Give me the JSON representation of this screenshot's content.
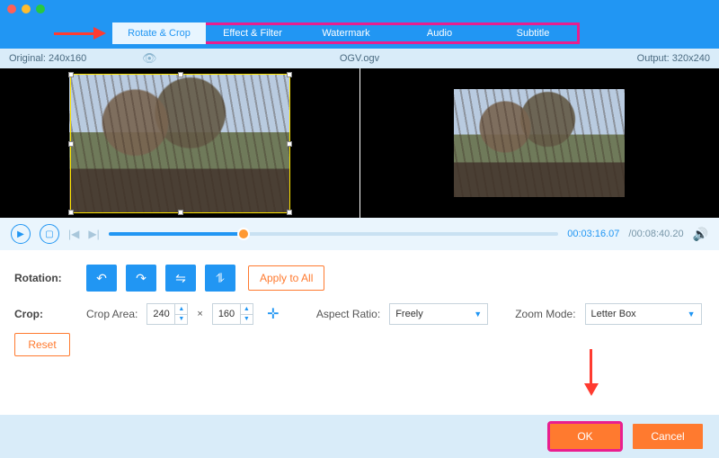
{
  "window": {
    "traffic": [
      "close",
      "min",
      "max"
    ]
  },
  "tabs": [
    "Rotate & Crop",
    "Effect & Filter",
    "Watermark",
    "Audio",
    "Subtitle"
  ],
  "active_tab_index": 0,
  "info": {
    "original_label": "Original: 240x160",
    "filename": "OGV.ogv",
    "output_label": "Output: 320x240"
  },
  "playback": {
    "current": "00:03:16.07",
    "duration": "/00:08:40.20",
    "progress_pct": 30
  },
  "rotation": {
    "label": "Rotation:",
    "buttons": [
      "rotate-left",
      "rotate-right",
      "flip-h",
      "flip-v"
    ],
    "apply_all": "Apply to All"
  },
  "crop": {
    "label": "Crop:",
    "area_label": "Crop Area:",
    "width": "240",
    "height": "160",
    "aspect_label": "Aspect Ratio:",
    "aspect_value": "Freely",
    "zoom_label": "Zoom Mode:",
    "zoom_value": "Letter Box",
    "reset": "Reset"
  },
  "footer": {
    "ok": "OK",
    "cancel": "Cancel"
  },
  "accent": "#2196f3"
}
